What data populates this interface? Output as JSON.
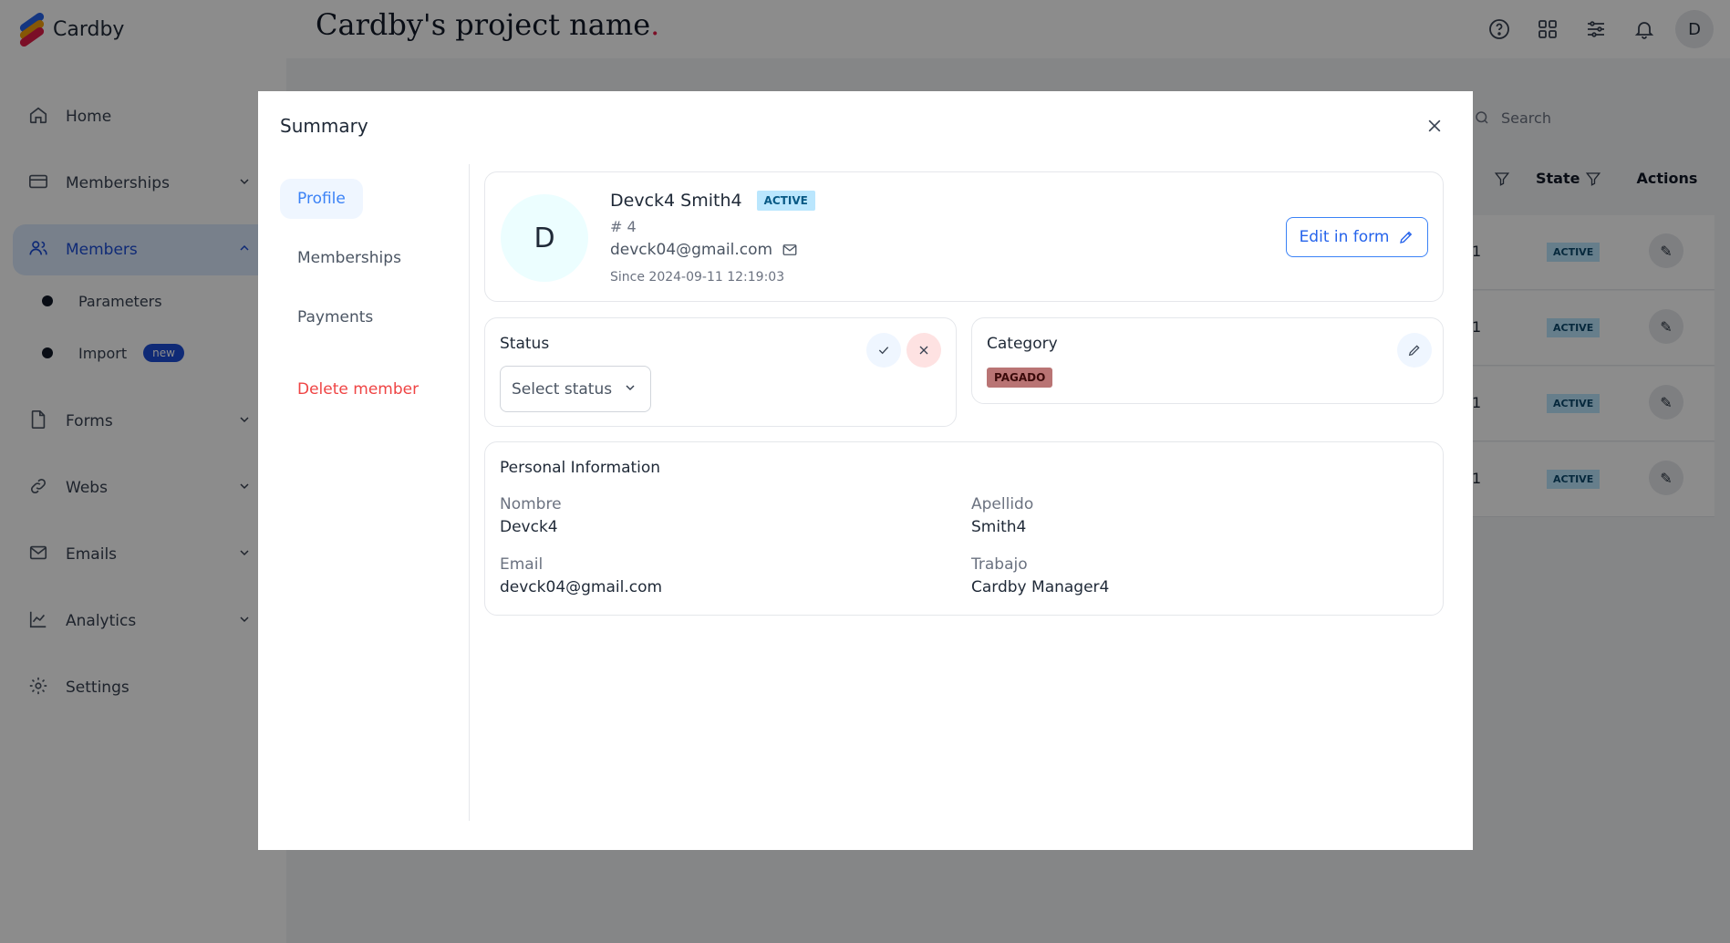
{
  "brand": {
    "name": "Cardby"
  },
  "header": {
    "project_title": "Cardby's project name",
    "project_dot": ".",
    "avatar_letter": "D"
  },
  "sidebar": {
    "items": [
      {
        "label": "Home"
      },
      {
        "label": "Memberships"
      },
      {
        "label": "Members"
      },
      {
        "label": "Forms"
      },
      {
        "label": "Webs"
      },
      {
        "label": "Emails"
      },
      {
        "label": "Analytics"
      },
      {
        "label": "Settings"
      }
    ],
    "subitems": [
      {
        "label": "Parameters"
      },
      {
        "label": "Import",
        "badge": "new"
      }
    ]
  },
  "background_table": {
    "search_placeholder": "Search",
    "headers": {
      "state": "State",
      "actions": "Actions"
    },
    "rows": [
      {
        "num": "1",
        "state": "ACTIVE"
      },
      {
        "num": "1",
        "state": "ACTIVE"
      },
      {
        "num": "1",
        "state": "ACTIVE"
      },
      {
        "num": "1",
        "state": "ACTIVE"
      }
    ]
  },
  "modal": {
    "title": "Summary",
    "nav": [
      {
        "label": "Profile"
      },
      {
        "label": "Memberships"
      },
      {
        "label": "Payments"
      },
      {
        "label": "Delete member"
      }
    ],
    "profile": {
      "avatar_letter": "D",
      "name": "Devck4 Smith4",
      "status_badge": "ACTIVE",
      "id": "# 4",
      "email": "devck04@gmail.com",
      "since": "Since 2024-09-11 12:19:03",
      "edit_label": "Edit in form"
    },
    "status": {
      "heading": "Status",
      "select_placeholder": "Select status"
    },
    "category": {
      "heading": "Category",
      "badge": "PAGADO"
    },
    "personal": {
      "heading": "Personal Information",
      "fields": [
        {
          "label": "Nombre",
          "value": "Devck4"
        },
        {
          "label": "Apellido",
          "value": "Smith4"
        },
        {
          "label": "Email",
          "value": "devck04@gmail.com"
        },
        {
          "label": "Trabajo",
          "value": "Cardby Manager4"
        }
      ]
    }
  },
  "colors": {
    "accent": "#3b82f6",
    "danger": "#ef4444",
    "active_badge": "#bae6fd",
    "category_badge": "#b97474"
  }
}
